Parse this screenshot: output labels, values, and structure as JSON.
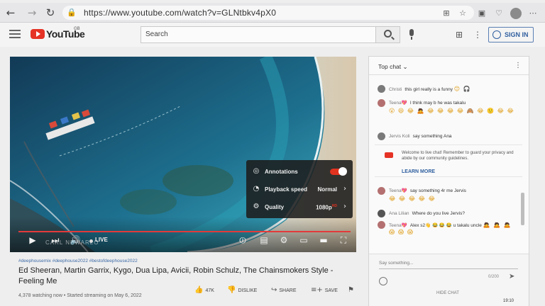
{
  "browser": {
    "url": "https://www.youtube.com/watch?v=GLNtbkv4pX0",
    "nav": {
      "back": "←",
      "forward": "→",
      "reload": "↻",
      "lock": "🔒"
    },
    "toolbar_icons": [
      "tab-grid-icon",
      "favorites-star-icon",
      "collections-icon",
      "extensions-heart-icon"
    ],
    "toolbar_glyphs": [
      "⊞",
      "☆",
      "▣",
      "♡"
    ],
    "menu": "⋯"
  },
  "header": {
    "logo_text": "YouTube",
    "region": "GB",
    "search_placeholder": "Search",
    "apps_icon": "⊞",
    "more_icon": "⋮",
    "signin_label": "SIGN IN"
  },
  "player": {
    "progress": 1.0,
    "live_label": "LIVE",
    "watermark": "CARL NEWARLO",
    "accent_color": "#e23a3a",
    "controls": {
      "play": "▶",
      "next": "⏭",
      "volume": "🔊",
      "autoplay": "⏼",
      "subtitles": "▤",
      "settings": "⚙",
      "miniplayer": "▭",
      "theater": "▬",
      "fullscreen": "⛶"
    },
    "settings_menu": {
      "annotations_label": "Annotations",
      "annotations_on": true,
      "playback_label": "Playback speed",
      "playback_value": "Normal",
      "quality_label": "Quality",
      "quality_value": "1080p",
      "quality_hd": "HD",
      "chevron": "›",
      "icons": {
        "annotations": "◎",
        "playback": "◔",
        "quality": "⚙"
      }
    }
  },
  "video": {
    "hashtags": "#deephousemix #deephouse2022 #bestofdeephouse2022",
    "title": "Ed Sheeran, Martin Garrix, Kygo, Dua Lipa, Avicii, Robin Schulz, The Chainsmokers Style - Feeling Me",
    "meta": "4,378 watching now • Started streaming on May 6, 2022",
    "likes": "47K",
    "dislike_label": "DISLIKE",
    "share_label": "SHARE",
    "save_label": "SAVE",
    "icons": {
      "like": "👍",
      "dislike": "👎",
      "share": "↪",
      "save": "≡+",
      "flag": "⚑"
    }
  },
  "chat": {
    "title": "Top chat",
    "chevron": "⌄",
    "more": "⋮",
    "messages": [
      {
        "author": "Christi",
        "text": "this girl really is a funny",
        "emojis": "😊 🎧"
      },
      {
        "author": "Teena💖",
        "text": "I think may b he was takalu",
        "emojis": "😮 😆 😂 🙇 😂 😂 😂 😂 🙈 😂 🙂 😂 😂"
      },
      {
        "author": "Jervis Koli",
        "text": "say something Ana",
        "emojis": ""
      },
      {
        "author": "Teena💖",
        "text": "say something 4r me Jervis",
        "emojis": "😂 😂 😂 😂 😂"
      },
      {
        "author": "Ana Lilian",
        "text": "Where do you live Jervis?",
        "emojis": ""
      },
      {
        "author": "Teena💖",
        "text": "Alex s2👋 😂 😂 😂 u takalu uncle",
        "emojis": "🙇 🙇 🙇 😱 😱 😱"
      }
    ],
    "pinned_text": "Welcome to live chat! Remember to guard your privacy and abide by our community guidelines.",
    "learn_more": "LEARN MORE",
    "input_placeholder": "Say something...",
    "char_count": "0/200",
    "send_icon": "➤",
    "hide_chat": "HIDE CHAT"
  },
  "system": {
    "clock": "19:10"
  }
}
